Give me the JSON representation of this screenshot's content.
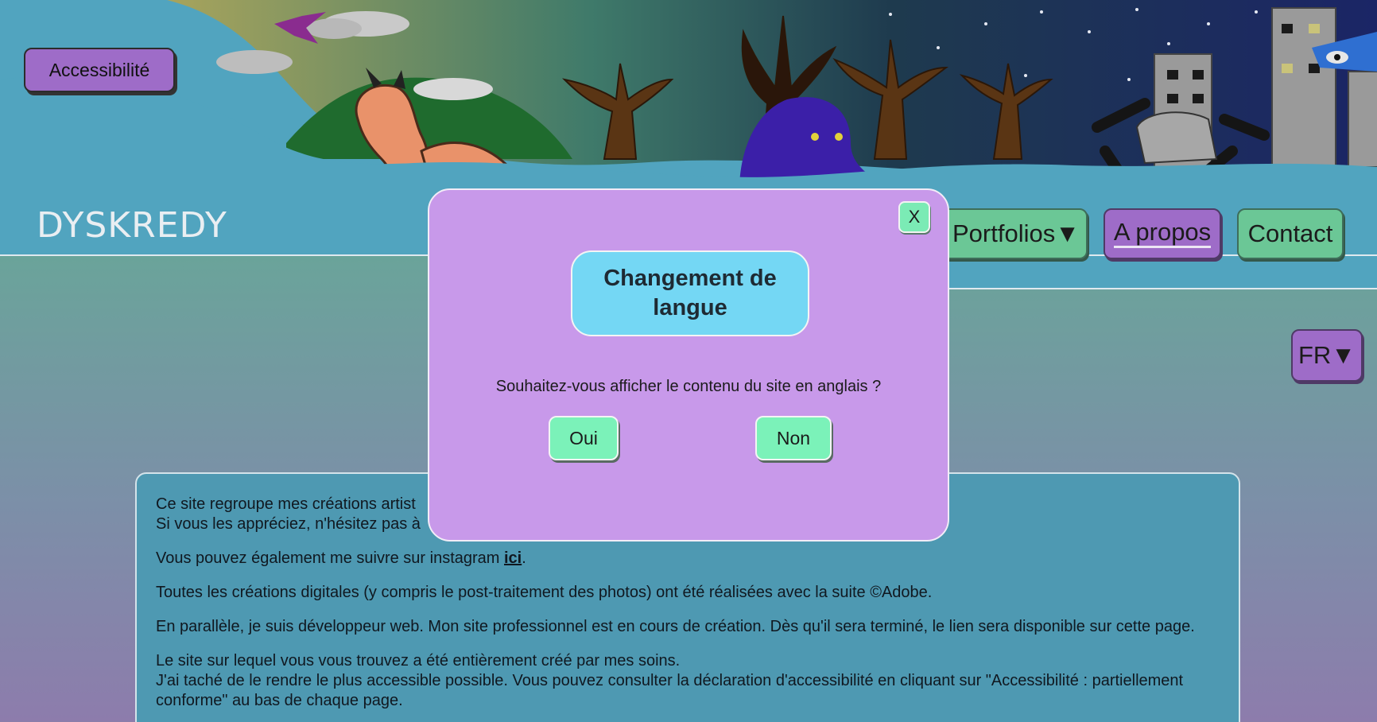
{
  "header": {
    "accessibility_label": "Accessibilité",
    "logo_text": "DYSKREDY"
  },
  "nav": {
    "portfolios_label": "Portfolios▼",
    "apropos_label": "A propos",
    "contact_label": "Contact"
  },
  "language": {
    "current": "FR▼"
  },
  "content": {
    "line1_a": "Ce site regroupe mes créations artist",
    "line1_b": "Si vous les appréciez, n'hésitez pas à",
    "instagram_text": "Vous pouvez également me suivre sur instagram ",
    "instagram_link": "ici",
    "instagram_end": ".",
    "digital": "Toutes les créations digitales (y compris le post-traitement des photos) ont été réalisées avec la suite ©Adobe.",
    "webdev": "En parallèle, je suis développeur web. Mon site professionnel est en cours de création. Dès qu'il sera terminé, le lien sera disponible sur cette page.",
    "site_a": "Le site sur lequel vous vous trouvez a été entièrement créé par mes soins.",
    "site_b": "J'ai taché de le rendre le plus accessible possible. Vous pouvez consulter la déclaration d'accessibilité en cliquant sur \"Accessibilité : partiellement conforme\" au bas de chaque page."
  },
  "modal": {
    "close_label": "X",
    "title": "Changement de langue",
    "question": "Souhaitez-vous afficher le contenu du site en anglais ?",
    "yes_label": "Oui",
    "no_label": "Non"
  },
  "colors": {
    "header_bg": "#51a4bf",
    "purple_button": "#9e6cc8",
    "green_button": "#6bc796",
    "modal_bg": "#c899ea",
    "modal_title_bg": "#74d7f4",
    "modal_button_bg": "#7bf2b9"
  }
}
